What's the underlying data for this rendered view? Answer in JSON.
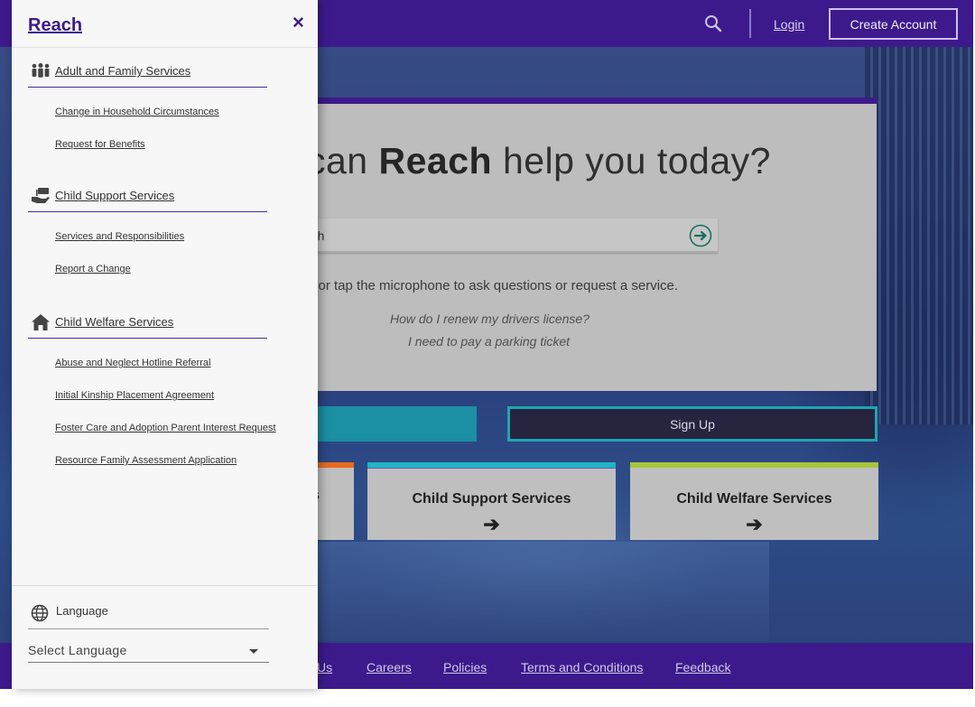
{
  "app": {
    "brand": "Reach"
  },
  "topbar": {
    "login": "Login",
    "create_account": "Create Account"
  },
  "hero": {
    "headline_pre": "can ",
    "headline_bold": "Reach",
    "headline_post": " help you today?",
    "search_value": "rch",
    "hint": "e or tap the microphone to ask questions or request a service.",
    "examples": [
      "How do I renew my drivers license?",
      "I need to pay a parking ticket"
    ]
  },
  "actions": {
    "sign_up": "Sign Up"
  },
  "tiles": [
    {
      "label": "s",
      "accent": "#e86a1f"
    },
    {
      "label": "Child Support Services",
      "arrow": "➔",
      "accent": "#1fb5c4"
    },
    {
      "label": "Child Welfare Services",
      "arrow": "➔",
      "accent": "#a8c63a"
    }
  ],
  "footer": {
    "links": [
      "Us",
      "Careers",
      "Policies",
      "Terms and Conditions",
      "Feedback"
    ]
  },
  "drawer": {
    "close": "×",
    "sections": [
      {
        "label": "Adult and Family Services",
        "icon": "family-icon",
        "items": [
          "Change in Household Circumstances",
          "Request for Benefits"
        ]
      },
      {
        "label": "Child Support Services",
        "icon": "hand-money-icon",
        "items": [
          "Services and Responsibilities",
          "Report a Change"
        ]
      },
      {
        "label": "Child Welfare Services",
        "icon": "home-icon",
        "items": [
          "Abuse and Neglect Hotline Referral",
          "Initial Kinship Placement Agreement",
          "Foster Care and Adoption Parent Interest Request",
          "Resource Family Assessment Application"
        ]
      }
    ],
    "language": {
      "label": "Language",
      "icon": "globe-icon",
      "select_value": "Select Language"
    }
  },
  "colors": {
    "brand_purple": "#3d1a8c",
    "teal": "#1b8fa3",
    "card_gray": "#bdbdbd",
    "drawer_bg": "#f6f7f6"
  }
}
